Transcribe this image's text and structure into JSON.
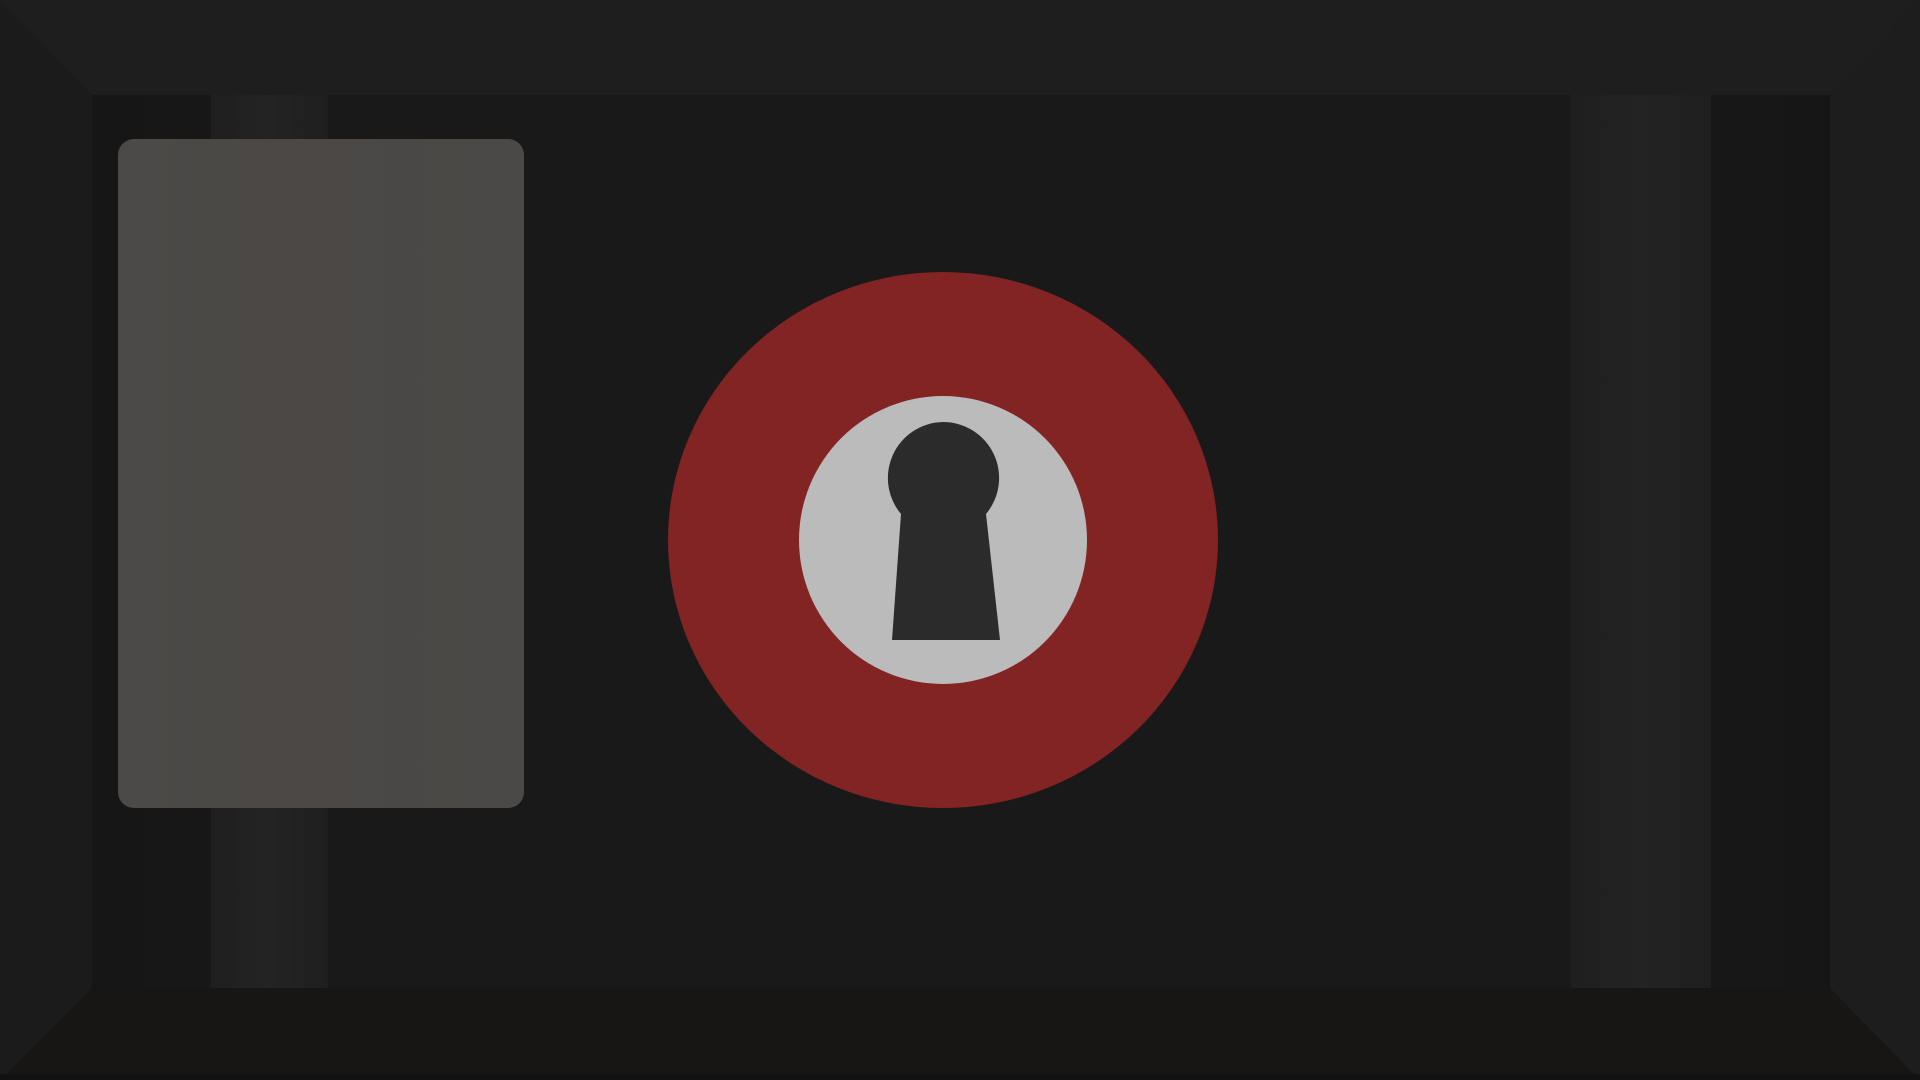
{
  "scene": {
    "background_color": "#1a1a1a",
    "frame_color": "#1e1e1e",
    "floor_color": "#171615"
  },
  "side_panel": {
    "color": "#4b4a48"
  },
  "lock": {
    "icon": "keyhole-icon",
    "ring_color": "#822324",
    "plate_color": "#bbbbbb",
    "keyhole_color": "#2b2b2b"
  }
}
